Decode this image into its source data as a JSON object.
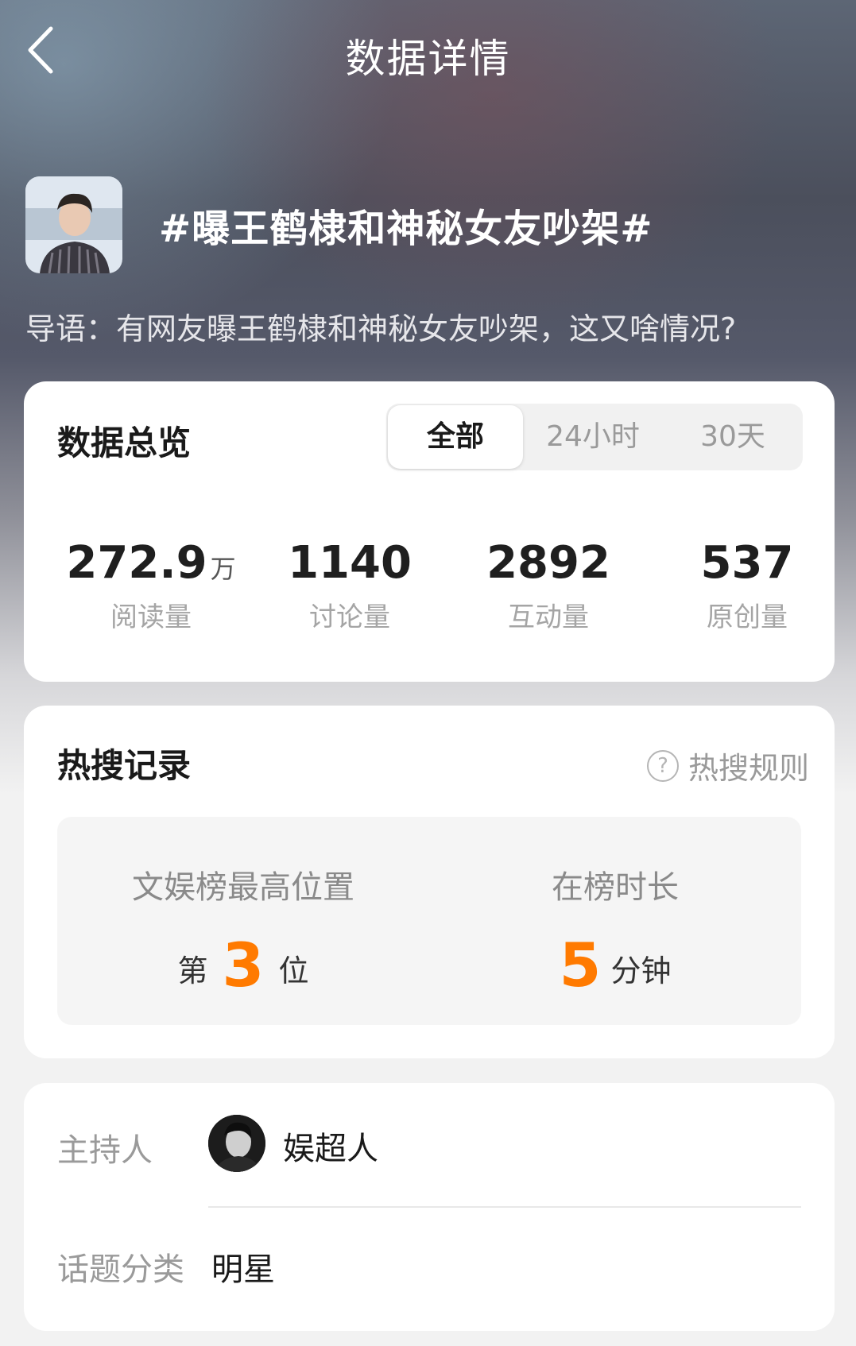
{
  "header": {
    "title": "数据详情"
  },
  "topic": {
    "title": "#曝王鹤棣和神秘女友吵架#",
    "intro": "导语：有网友曝王鹤棣和神秘女友吵架，这又啥情况?"
  },
  "overview": {
    "heading": "数据总览",
    "tabs": [
      {
        "label": "全部",
        "active": true
      },
      {
        "label": "24小时",
        "active": false
      },
      {
        "label": "30天",
        "active": false
      }
    ],
    "stats": [
      {
        "value": "272.9",
        "unit": "万",
        "label": "阅读量"
      },
      {
        "value": "1140",
        "unit": "",
        "label": "讨论量"
      },
      {
        "value": "2892",
        "unit": "",
        "label": "互动量"
      },
      {
        "value": "537",
        "unit": "",
        "label": "原创量"
      }
    ]
  },
  "hot_search": {
    "heading": "热搜记录",
    "rules_link": "热搜规则",
    "highest_label": "文娱榜最高位置",
    "highest_prefix": "第",
    "highest_value": "3",
    "highest_suffix": "位",
    "duration_label": "在榜时长",
    "duration_value": "5",
    "duration_unit": "分钟",
    "accent_color": "#ff7a00"
  },
  "info": {
    "host_label": "主持人",
    "host_name": "娱超人",
    "category_label": "话题分类",
    "category_value": "明星"
  }
}
